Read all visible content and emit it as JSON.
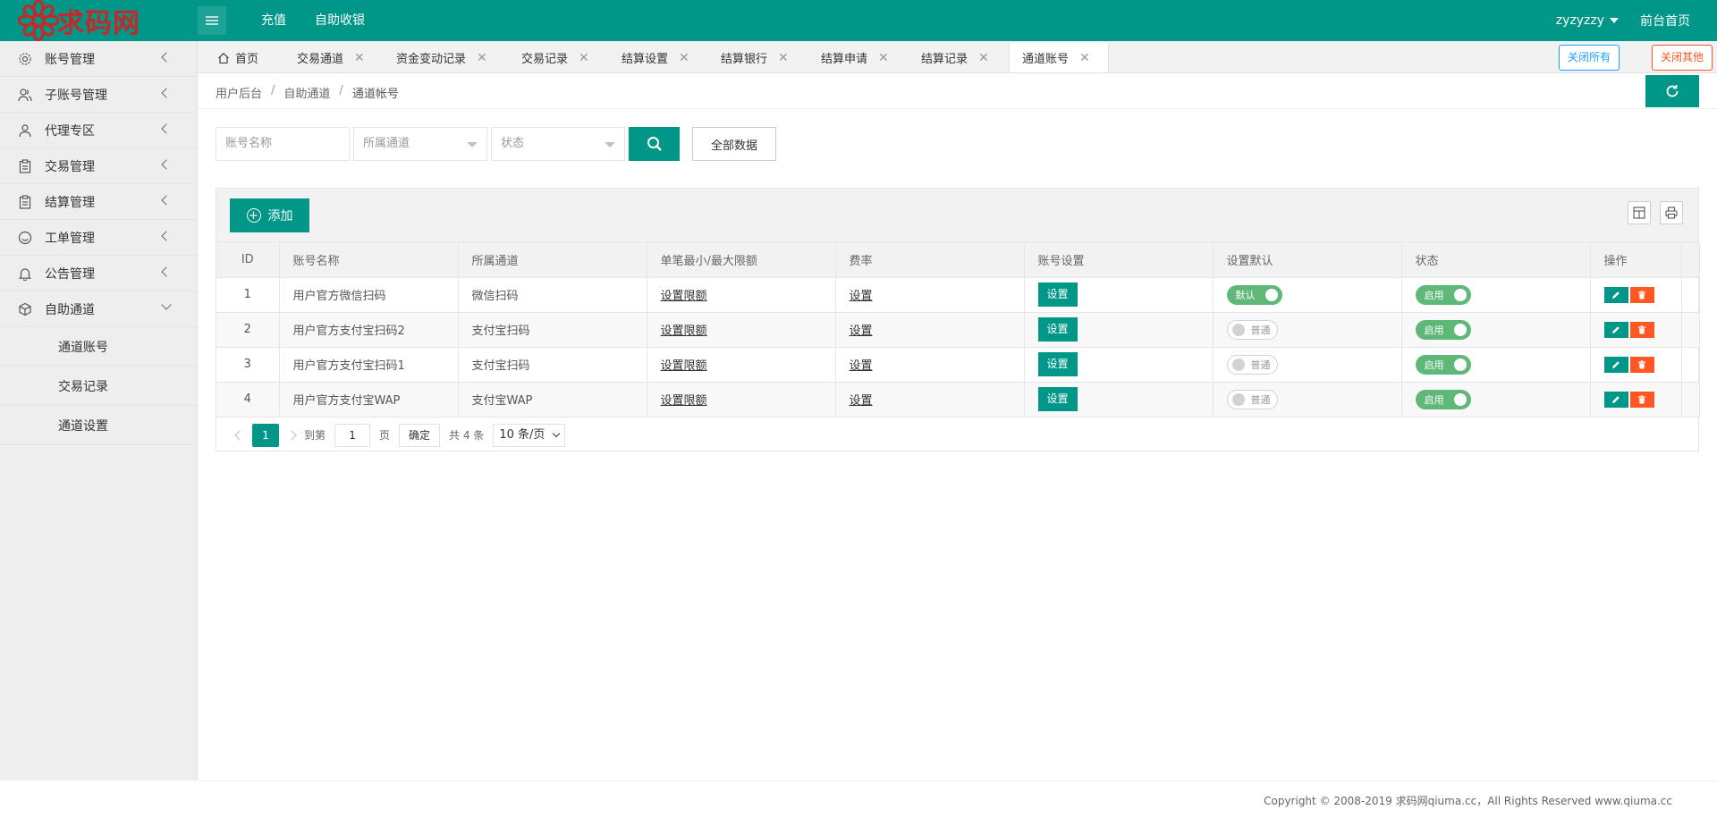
{
  "header": {
    "logo_text": "求码网",
    "nav": [
      "充值",
      "自助收银"
    ],
    "username": "zyzyzzy",
    "home_link": "前台首页"
  },
  "sidebar": {
    "items": [
      {
        "label": "账号管理",
        "icon": "gear-icon"
      },
      {
        "label": "子账号管理",
        "icon": "users-icon"
      },
      {
        "label": "代理专区",
        "icon": "user-icon"
      },
      {
        "label": "交易管理",
        "icon": "clipboard-icon"
      },
      {
        "label": "结算管理",
        "icon": "clipboard-icon"
      },
      {
        "label": "工单管理",
        "icon": "smile-icon"
      },
      {
        "label": "公告管理",
        "icon": "bell-icon"
      },
      {
        "label": "自助通道",
        "icon": "cube-icon"
      }
    ],
    "sub_items": [
      "通道账号",
      "交易记录",
      "通道设置"
    ]
  },
  "tabs": {
    "home": "首页",
    "items": [
      "交易通道",
      "资金变动记录",
      "交易记录",
      "结算设置",
      "结算银行",
      "结算申请",
      "结算记录",
      "通道账号"
    ],
    "close_all": "关闭所有",
    "close_other": "关闭其他"
  },
  "breadcrumb": [
    "用户后台",
    "自助通道",
    "通道帐号"
  ],
  "search": {
    "account_placeholder": "账号名称",
    "channel_placeholder": "所属通道",
    "status_placeholder": "状态",
    "all_data": "全部数据"
  },
  "toolbar": {
    "add_label": "添加"
  },
  "table": {
    "columns": [
      "ID",
      "账号名称",
      "所属通道",
      "单笔最小/最大限额",
      "费率",
      "账号设置",
      "设置默认",
      "状态",
      "操作"
    ],
    "limit_link": "设置限额",
    "rate_link": "设置",
    "set_button": "设置",
    "rows": [
      {
        "id": "1",
        "name": "用户官方微信扫码",
        "channel": "微信扫码",
        "default": "默认",
        "default_on": true,
        "status": "启用"
      },
      {
        "id": "2",
        "name": "用户官方支付宝扫码2",
        "channel": "支付宝扫码",
        "default": "普通",
        "default_on": false,
        "status": "启用"
      },
      {
        "id": "3",
        "name": "用户官方支付宝扫码1",
        "channel": "支付宝扫码",
        "default": "普通",
        "default_on": false,
        "status": "启用"
      },
      {
        "id": "4",
        "name": "用户官方支付宝WAP",
        "channel": "支付宝WAP",
        "default": "普通",
        "default_on": false,
        "status": "启用"
      }
    ]
  },
  "pager": {
    "current": "1",
    "goto_label": "到第",
    "page_input": "1",
    "page_unit": "页",
    "ok": "确定",
    "total": "共 4 条",
    "page_size": "10 条/页"
  },
  "footer": {
    "copyright": "Copyright © 2008-2019 求码网qiuma.cc，All Rights Reserved www.qiuma.cc"
  },
  "colors": {
    "primary": "#009688",
    "switch_on": "#5fb878",
    "danger": "#ff5722",
    "info": "#1e9fff"
  }
}
